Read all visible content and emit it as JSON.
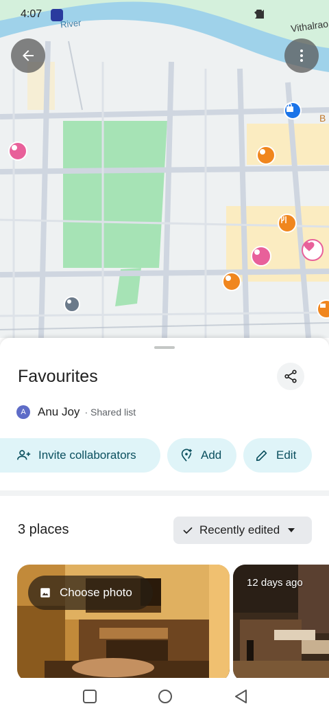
{
  "status_bar": {
    "time": "4:07"
  },
  "map": {
    "river_label": "River",
    "edge_label": "Vithalrao",
    "edge_label_b": "B",
    "colors": {
      "road": "#cfd6e0",
      "water": "#9fd2ea",
      "park": "#a6e3b5",
      "commercial": "#fbecc1"
    }
  },
  "sheet": {
    "title": "Favourites",
    "owner": {
      "avatar_letter": "A",
      "name": "Anu Joy",
      "subtitle": "· Shared list"
    },
    "chips": {
      "invite": "Invite collaborators",
      "add": "Add",
      "edit": "Edit"
    },
    "places_count": "3 places",
    "sort_label": "Recently edited",
    "cards": [
      {
        "button": "Choose photo"
      },
      {
        "time_ago": "12 days ago"
      }
    ]
  }
}
